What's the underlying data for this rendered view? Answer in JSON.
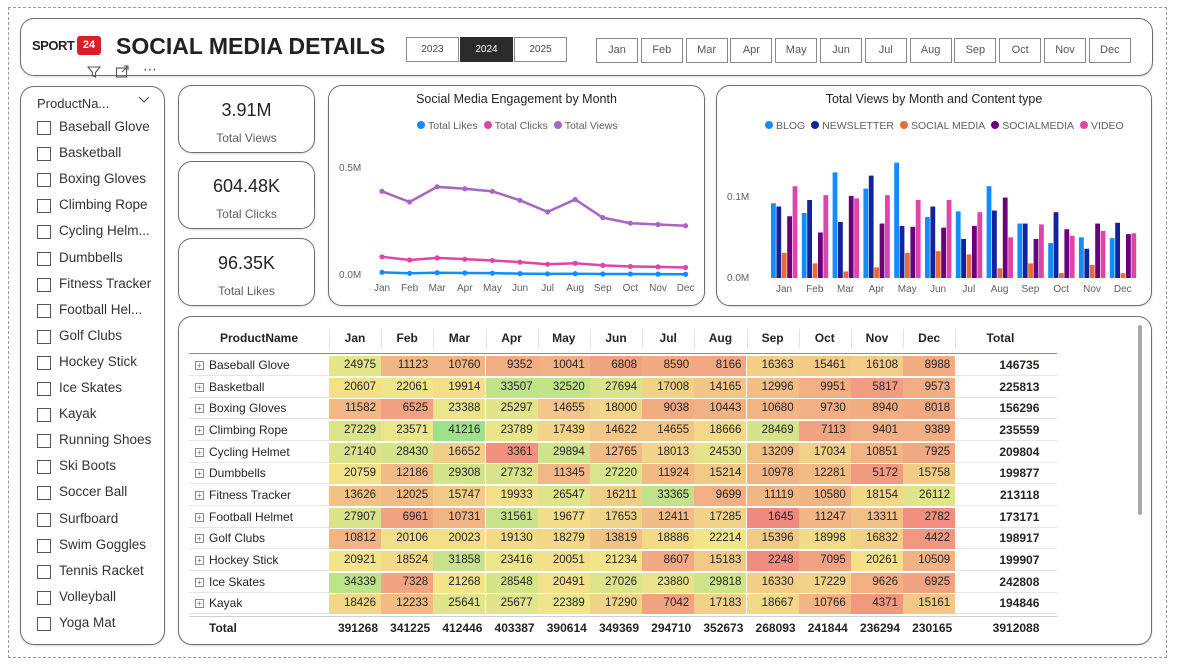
{
  "brand": {
    "logo_text": "SPORT",
    "logo_badge": "24",
    "title": "SOCIAL MEDIA DETAILS"
  },
  "years": [
    {
      "label": "2023",
      "selected": false
    },
    {
      "label": "2024",
      "selected": true
    },
    {
      "label": "2025",
      "selected": false
    }
  ],
  "months": [
    "Jan",
    "Feb",
    "Mar",
    "Apr",
    "May",
    "Jun",
    "Jul",
    "Aug",
    "Sep",
    "Oct",
    "Nov",
    "Dec"
  ],
  "visual_tools": {
    "filter": "filter-icon",
    "focus": "focus-mode-icon",
    "more": "more-options-icon",
    "more_glyph": "⋯"
  },
  "slicer": {
    "header": "ProductNa...",
    "items": [
      "Baseball Glove",
      "Basketball",
      "Boxing Gloves",
      "Climbing Rope",
      "Cycling Helm...",
      "Dumbbells",
      "Fitness Tracker",
      "Football Hel...",
      "Golf Clubs",
      "Hockey Stick",
      "Ice Skates",
      "Kayak",
      "Running Shoes",
      "Ski Boots",
      "Soccer Ball",
      "Surfboard",
      "Swim Goggles",
      "Tennis Racket",
      "Volleyball",
      "Yoga Mat"
    ]
  },
  "kpis": [
    {
      "value": "3.91M",
      "label": "Total Views"
    },
    {
      "value": "604.48K",
      "label": "Total Clicks"
    },
    {
      "value": "96.35K",
      "label": "Total Likes"
    }
  ],
  "chart_data": [
    {
      "type": "line",
      "title": "Social Media Engagement by Month",
      "x": [
        "Jan",
        "Feb",
        "Mar",
        "Apr",
        "May",
        "Jun",
        "Jul",
        "Aug",
        "Sep",
        "Oct",
        "Nov",
        "Dec"
      ],
      "yticks": [
        "0.0M",
        "0.5M"
      ],
      "ylim": [
        0,
        0.5
      ],
      "series": [
        {
          "name": "Total Likes",
          "color": "#118DFF",
          "values": [
            0.0125,
            0.008,
            0.0105,
            0.0095,
            0.0085,
            0.0065,
            0.0055,
            0.006,
            0.0045,
            0.0045,
            0.004,
            0.0035
          ]
        },
        {
          "name": "Total Clicks",
          "color": "#E044A7",
          "values": [
            0.085,
            0.07,
            0.08,
            0.074,
            0.068,
            0.06,
            0.05,
            0.055,
            0.045,
            0.04,
            0.038,
            0.035
          ]
        },
        {
          "name": "Total Views",
          "color": "#A766C2",
          "values": [
            0.391,
            0.341,
            0.412,
            0.403,
            0.391,
            0.349,
            0.295,
            0.353,
            0.268,
            0.242,
            0.236,
            0.23
          ]
        }
      ],
      "legend_position": "top-center"
    },
    {
      "type": "bar",
      "title": "Total Views by Month and Content type",
      "categories": [
        "Jan",
        "Feb",
        "Mar",
        "Apr",
        "May",
        "Jun",
        "Jul",
        "Aug",
        "Sep",
        "Oct",
        "Nov",
        "Dec"
      ],
      "yticks": [
        "0.0M",
        "0.1M"
      ],
      "ylim": [
        0,
        0.16
      ],
      "series": [
        {
          "name": "BLOG",
          "color": "#118DFF",
          "values": [
            0.092,
            0.08,
            0.13,
            0.11,
            0.142,
            0.075,
            0.082,
            0.113,
            0.067,
            0.043,
            0.05,
            0.049
          ]
        },
        {
          "name": "NEWSLETTER",
          "color": "#12239E",
          "values": [
            0.088,
            0.096,
            0.069,
            0.126,
            0.064,
            0.088,
            0.048,
            0.083,
            0.067,
            0.081,
            0.036,
            0.068
          ]
        },
        {
          "name": "SOCIAL MEDIA",
          "color": "#E66C37",
          "values": [
            0.031,
            0.018,
            0.008,
            0.013,
            0.031,
            0.033,
            0.029,
            0.012,
            0.018,
            0.006,
            0.016,
            0.006
          ]
        },
        {
          "name": "SOCIALMEDIA",
          "color": "#6B007B",
          "values": [
            0.076,
            0.056,
            0.101,
            0.067,
            0.063,
            0.062,
            0.064,
            0.099,
            0.048,
            0.06,
            0.067,
            0.054
          ]
        },
        {
          "name": "VIDEO",
          "color": "#E044A7",
          "values": [
            0.113,
            0.102,
            0.098,
            0.102,
            0.096,
            0.096,
            0.081,
            0.05,
            0.066,
            0.052,
            0.058,
            0.055
          ]
        }
      ],
      "legend_position": "top-center"
    }
  ],
  "table": {
    "header_name": "ProductName",
    "header_total": "Total",
    "rows": [
      {
        "name": "Baseball Glove",
        "values": [
          24975,
          11123,
          10760,
          9352,
          10041,
          6808,
          8590,
          8166,
          16363,
          15461,
          16108,
          8988
        ],
        "total": 146735
      },
      {
        "name": "Basketball",
        "values": [
          20607,
          22061,
          19914,
          33507,
          32520,
          27694,
          17008,
          14165,
          12996,
          9951,
          5817,
          9573
        ],
        "total": 225813
      },
      {
        "name": "Boxing Gloves",
        "values": [
          11582,
          6525,
          23388,
          25297,
          14655,
          18000,
          9038,
          10443,
          10680,
          9730,
          8940,
          8018
        ],
        "total": 156296
      },
      {
        "name": "Climbing Rope",
        "values": [
          27229,
          23571,
          41216,
          23789,
          17439,
          14622,
          14655,
          18666,
          28469,
          7113,
          9401,
          9389
        ],
        "total": 235559
      },
      {
        "name": "Cycling Helmet",
        "values": [
          27140,
          28430,
          16652,
          3361,
          29894,
          12765,
          18013,
          24530,
          13209,
          17034,
          10851,
          7925
        ],
        "total": 209804
      },
      {
        "name": "Dumbbells",
        "values": [
          20759,
          12186,
          29308,
          27732,
          11345,
          27220,
          11924,
          15214,
          10978,
          12281,
          5172,
          15758
        ],
        "total": 199877
      },
      {
        "name": "Fitness Tracker",
        "values": [
          13626,
          12025,
          15747,
          19933,
          26547,
          16211,
          33365,
          9699,
          11119,
          10580,
          18154,
          26112
        ],
        "total": 213118
      },
      {
        "name": "Football Helmet",
        "values": [
          27907,
          6961,
          10731,
          31561,
          19677,
          17653,
          12411,
          17285,
          1645,
          11247,
          13311,
          2782
        ],
        "total": 173171
      },
      {
        "name": "Golf Clubs",
        "values": [
          10812,
          20106,
          20023,
          19130,
          18279,
          13819,
          18886,
          22214,
          15396,
          18998,
          16832,
          4422
        ],
        "total": 198917
      },
      {
        "name": "Hockey Stick",
        "values": [
          20921,
          18524,
          31858,
          23416,
          20051,
          21234,
          8607,
          15183,
          2248,
          7095,
          20261,
          10509
        ],
        "total": 199907
      },
      {
        "name": "Ice Skates",
        "values": [
          34339,
          7328,
          21268,
          28548,
          20491,
          27026,
          23880,
          29818,
          16330,
          17229,
          9626,
          6925
        ],
        "total": 242808
      },
      {
        "name": "Kayak",
        "values": [
          18426,
          12233,
          25641,
          25677,
          22389,
          17290,
          7042,
          17183,
          18667,
          10766,
          4371,
          15161
        ],
        "total": 194846
      }
    ],
    "totals": {
      "label": "Total",
      "values": [
        391268,
        341225,
        412446,
        403387,
        390614,
        349369,
        294710,
        352673,
        268093,
        241844,
        236294,
        230165
      ],
      "grand_total": 3912088
    },
    "heat_colors": {
      "low": "#F08A7E",
      "mid": "#F3E58A",
      "high": "#9FE08A"
    }
  }
}
